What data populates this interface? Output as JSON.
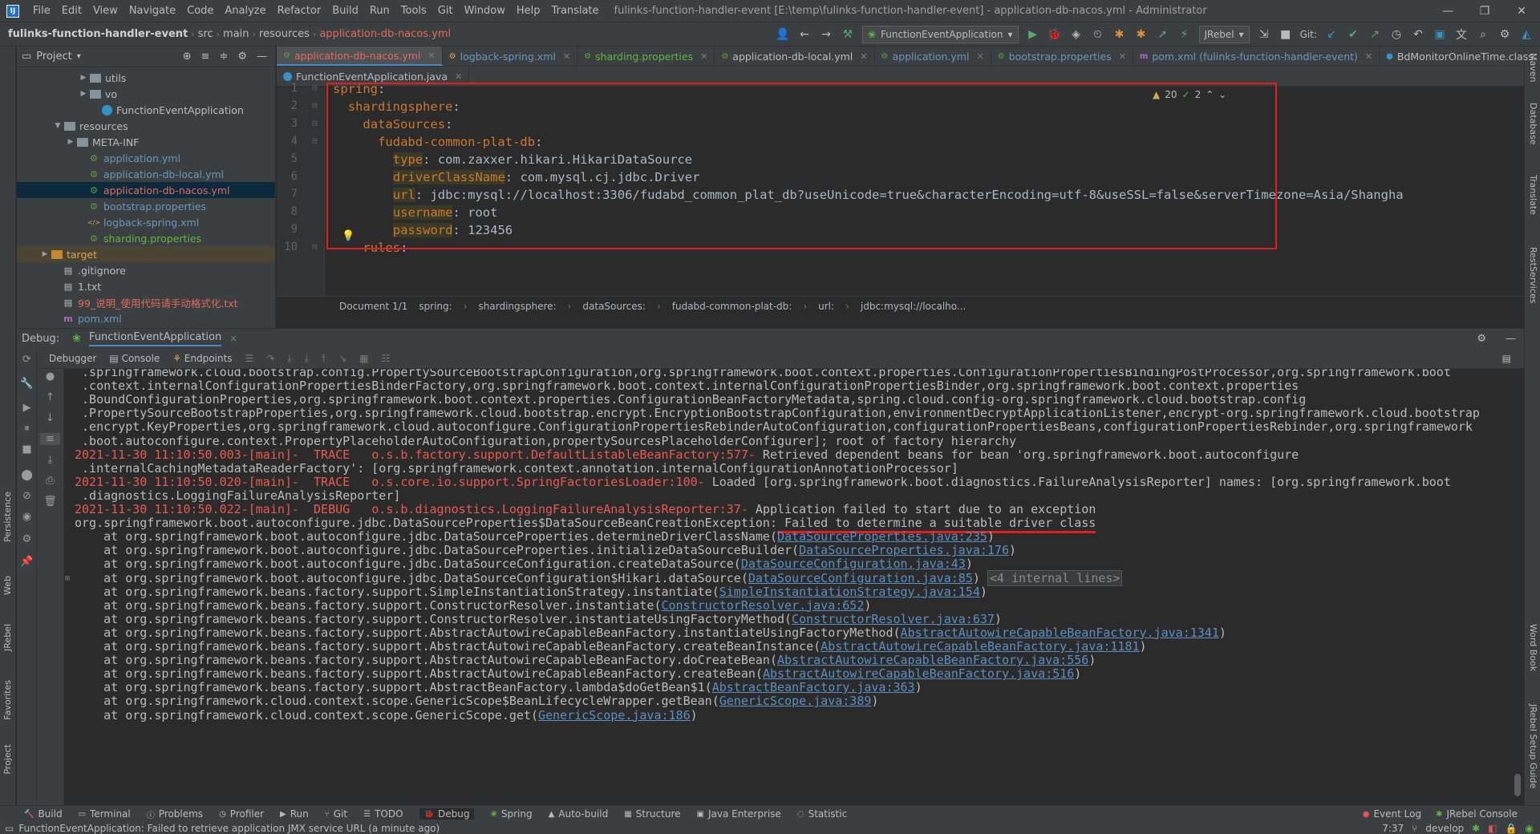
{
  "app": {
    "icon": "intellij-logo-icon",
    "logo_text": "IJ"
  },
  "menu": [
    "File",
    "Edit",
    "View",
    "Navigate",
    "Code",
    "Analyze",
    "Refactor",
    "Build",
    "Run",
    "Tools",
    "Git",
    "Window",
    "Help",
    "Translate"
  ],
  "window_title": "fulinks-function-handler-event [E:\\temp\\fulinks-function-handler-event] - application-db-nacos.yml - Administrator",
  "window_controls": {
    "minimize": "—",
    "restore": "❐",
    "close": "✕"
  },
  "breadcrumb": {
    "project": "fulinks-function-handler-event",
    "parts": [
      "src",
      "main",
      "resources"
    ],
    "file": "application-db-nacos.yml"
  },
  "run_config": "FunctionEventApplication",
  "jrebel_combo": "JRebel",
  "git_label": "Git:",
  "project_panel": {
    "title": "Project",
    "rows": [
      {
        "label": "utils",
        "icon": "folder-icon",
        "arrow": "▶",
        "indent": 76
      },
      {
        "label": "vo",
        "icon": "folder-icon",
        "arrow": "▶",
        "indent": 76
      },
      {
        "label": "FunctionEventApplication",
        "icon": "class-icon",
        "arrow": "",
        "indent": 90
      },
      {
        "label": "resources",
        "icon": "folder-icon",
        "arrow": "▼",
        "indent": 44
      },
      {
        "label": "META-INF",
        "icon": "folder-icon",
        "arrow": "▶",
        "indent": 60
      },
      {
        "label": "application.yml",
        "icon": "yml-file-icon",
        "arrow": "",
        "indent": 74
      },
      {
        "label": "application-db-local.yml",
        "icon": "yml-file-icon",
        "arrow": "",
        "indent": 74
      },
      {
        "label": "application-db-nacos.yml",
        "icon": "yml-file-icon",
        "arrow": "",
        "indent": 74,
        "selected": true
      },
      {
        "label": "bootstrap.properties",
        "icon": "properties-file-icon",
        "arrow": "",
        "indent": 74
      },
      {
        "label": "logback-spring.xml",
        "icon": "xml-file-icon",
        "arrow": "",
        "indent": 74
      },
      {
        "label": "sharding.properties",
        "icon": "properties-file-icon",
        "arrow": "",
        "indent": 74
      },
      {
        "label": "target",
        "icon": "folder-icon",
        "arrow": "▶",
        "indent": 28,
        "highlight": true
      },
      {
        "label": ".gitignore",
        "icon": "text-file-icon",
        "arrow": "",
        "indent": 42
      },
      {
        "label": "1.txt",
        "icon": "text-file-icon",
        "arrow": "",
        "indent": 42
      },
      {
        "label": "99_说明_使用代码请手动格式化.txt",
        "icon": "text-file-icon",
        "arrow": "",
        "indent": 42,
        "red": true
      },
      {
        "label": "pom.xml",
        "icon": "maven-file-icon",
        "arrow": "",
        "indent": 42
      }
    ]
  },
  "editor_tabs": [
    {
      "label": "application-db-nacos.yml",
      "active": true,
      "color": "#e06c58",
      "icon": "yml-file-icon"
    },
    {
      "label": "logback-spring.xml",
      "color": "#6897bb",
      "icon": "xml-file-icon"
    },
    {
      "label": "sharding.properties",
      "color": "#62b543",
      "icon": "properties-file-icon"
    },
    {
      "label": "application-db-local.yml",
      "color": "#bbbbbb",
      "icon": "yml-file-icon"
    },
    {
      "label": "application.yml",
      "color": "#6897bb",
      "icon": "yml-file-icon"
    },
    {
      "label": "bootstrap.properties",
      "color": "#6897bb",
      "icon": "properties-file-icon"
    },
    {
      "label": "pom.xml (fulinks-function-handler-event)",
      "color": "#6897bb",
      "icon": "maven-file-icon"
    },
    {
      "label": "BdMonitorOnlineTime.class",
      "color": "#bbbbbb",
      "icon": "class-icon"
    }
  ],
  "editor_tab_row2": {
    "label": "FunctionEventApplication.java"
  },
  "code_lines": [
    {
      "n": "1",
      "key": "spring",
      "sep": ":",
      "val": ""
    },
    {
      "n": "2",
      "key": "shardingsphere",
      "sep": ":",
      "val": ""
    },
    {
      "n": "3",
      "key": "dataSources",
      "sep": ":",
      "val": ""
    },
    {
      "n": "4",
      "key": "fudabd-common-plat-db",
      "sep": ":",
      "val": ""
    },
    {
      "n": "5",
      "key": "type",
      "sep": ":",
      "val": " com.zaxxer.hikari.HikariDataSource"
    },
    {
      "n": "6",
      "key": "driverClassName",
      "sep": ":",
      "val": " com.mysql.cj.jdbc.Driver"
    },
    {
      "n": "7",
      "key": "url",
      "sep": ":",
      "val": " jdbc:mysql://localhost:3306/fudabd_common_plat_db?useUnicode=true&characterEncoding=utf-8&useSSL=false&serverTimezone=Asia/Shangha"
    },
    {
      "n": "8",
      "key": "username",
      "sep": ":",
      "val": " root"
    },
    {
      "n": "9",
      "key": "password",
      "sep": ":",
      "val": " 123456"
    },
    {
      "n": "10",
      "key": "rules",
      "sep": ":",
      "val": ""
    }
  ],
  "inspection": {
    "warnings": "20",
    "ok": "2"
  },
  "editor_breadcrumb": [
    "Document 1/1",
    "spring:",
    "shardingsphere:",
    "dataSources:",
    "fudabd-common-plat-db:",
    "url:",
    "jdbc:mysql://localho..."
  ],
  "debug": {
    "label": "Debug:",
    "config": "FunctionEventApplication",
    "tabs": [
      "Debugger",
      "Console",
      "Endpoints"
    ]
  },
  "console_lines": [
    {
      "t": " .springframework.cloud.bootstrap.config.PropertySourceBootstrapConfiguration,org.springframework.boot.context.properties.ConfigurationPropertiesBindingPostProcessor,org.springframework.boot"
    },
    {
      "t": " .context.internalConfigurationPropertiesBinderFactory,org.springframework.boot.context.internalConfigurationPropertiesBinder,org.springframework.boot.context.properties"
    },
    {
      "t": " .BoundConfigurationProperties,org.springframework.boot.context.properties.ConfigurationBeanFactoryMetadata,spring.cloud.config-org.springframework.cloud.bootstrap.config"
    },
    {
      "t": " .PropertySourceBootstrapProperties,org.springframework.cloud.bootstrap.encrypt.EncryptionBootstrapConfiguration,environmentDecryptApplicationListener,encrypt-org.springframework.cloud.bootstrap"
    },
    {
      "t": " .encrypt.KeyProperties,org.springframework.cloud.autoconfigure.ConfigurationPropertiesRebinderAutoConfiguration,configurationPropertiesBeans,configurationPropertiesRebinder,org.springframework"
    },
    {
      "t": " .boot.autoconfigure.context.PropertyPlaceholderAutoConfiguration,propertySourcesPlaceholderConfigurer]; root of factory hierarchy"
    },
    {
      "r": "2021-11-30 11:10:50.003-[main]-  TRACE   o.s.b.factory.support.DefaultListableBeanFactory:577-",
      "t": " Retrieved dependent beans for bean 'org.springframework.boot.autoconfigure"
    },
    {
      "t": " .internalCachingMetadataReaderFactory': [org.springframework.context.annotation.internalConfigurationAnnotationProcessor]"
    },
    {
      "r": "2021-11-30 11:10:50.020-[main]-  TRACE   o.s.core.io.support.SpringFactoriesLoader:100-",
      "t": " Loaded [org.springframework.boot.diagnostics.FailureAnalysisReporter] names: [org.springframework.boot"
    },
    {
      "t": " .diagnostics.LoggingFailureAnalysisReporter]"
    },
    {
      "r": "2021-11-30 11:10:50.022-[main]-  DEBUG   o.s.b.diagnostics.LoggingFailureAnalysisReporter:37-",
      "t": " Application failed to start due to an exception"
    },
    {
      "t": "org.springframework.boot.autoconfigure.jdbc.DataSourceProperties$DataSourceBeanCreationException:",
      "u": " Failed to determine a suitable driver class"
    },
    {
      "t": "    at org.springframework.boot.autoconfigure.jdbc.DataSourceProperties.determineDriverClassName(",
      "l": "DataSourceProperties.java:235",
      "e": ")"
    },
    {
      "t": "    at org.springframework.boot.autoconfigure.jdbc.DataSourceProperties.initializeDataSourceBuilder(",
      "l": "DataSourceProperties.java:176",
      "e": ")"
    },
    {
      "t": "    at org.springframework.boot.autoconfigure.jdbc.DataSourceConfiguration.createDataSource(",
      "l": "DataSourceConfiguration.java:43",
      "e": ")"
    },
    {
      "t": "    at org.springframework.boot.autoconfigure.jdbc.DataSourceConfiguration$Hikari.dataSource(",
      "l": "DataSourceConfiguration.java:85",
      "e": ") ",
      "f": "<4 internal lines>"
    },
    {
      "t": "    at org.springframework.beans.factory.support.SimpleInstantiationStrategy.instantiate(",
      "l": "SimpleInstantiationStrategy.java:154",
      "e": ")"
    },
    {
      "t": "    at org.springframework.beans.factory.support.ConstructorResolver.instantiate(",
      "l": "ConstructorResolver.java:652",
      "e": ")"
    },
    {
      "t": "    at org.springframework.beans.factory.support.ConstructorResolver.instantiateUsingFactoryMethod(",
      "l": "ConstructorResolver.java:637",
      "e": ")"
    },
    {
      "t": "    at org.springframework.beans.factory.support.AbstractAutowireCapableBeanFactory.instantiateUsingFactoryMethod(",
      "l": "AbstractAutowireCapableBeanFactory.java:1341",
      "e": ")"
    },
    {
      "t": "    at org.springframework.beans.factory.support.AbstractAutowireCapableBeanFactory.createBeanInstance(",
      "l": "AbstractAutowireCapableBeanFactory.java:1181",
      "e": ")"
    },
    {
      "t": "    at org.springframework.beans.factory.support.AbstractAutowireCapableBeanFactory.doCreateBean(",
      "l": "AbstractAutowireCapableBeanFactory.java:556",
      "e": ")"
    },
    {
      "t": "    at org.springframework.beans.factory.support.AbstractAutowireCapableBeanFactory.createBean(",
      "l": "AbstractAutowireCapableBeanFactory.java:516",
      "e": ")"
    },
    {
      "t": "    at org.springframework.beans.factory.support.AbstractBeanFactory.lambda$doGetBean$1(",
      "l": "AbstractBeanFactory.java:363",
      "e": ")"
    },
    {
      "t": "    at org.springframework.cloud.context.scope.GenericScope$BeanLifecycleWrapper.getBean(",
      "l": "GenericScope.java:389",
      "e": ")"
    },
    {
      "t": "    at org.springframework.cloud.context.scope.GenericScope.get(",
      "l": "GenericScope.java:186",
      "e": ")"
    }
  ],
  "bottom_tools": [
    "Build",
    "Terminal",
    "Problems",
    "Profiler",
    "Run",
    "Git",
    "TODO",
    "Debug",
    "Spring",
    "Auto-build",
    "Structure",
    "Java Enterprise",
    "Statistic"
  ],
  "bottom_right": [
    "Event Log",
    "JRebel Console"
  ],
  "status": {
    "message": "FunctionEventApplication: Failed to retrieve application JMX service URL (a minute ago)",
    "position": "7:37",
    "branch": "develop"
  },
  "left_strip_tabs": [
    "Project",
    "Favorites",
    "JRebel",
    "Web",
    "Persistence"
  ],
  "right_strip_tabs": [
    "Maven",
    "Database",
    "Translate",
    "RestServices",
    "Word Book",
    "JRebel Setup Guide"
  ]
}
